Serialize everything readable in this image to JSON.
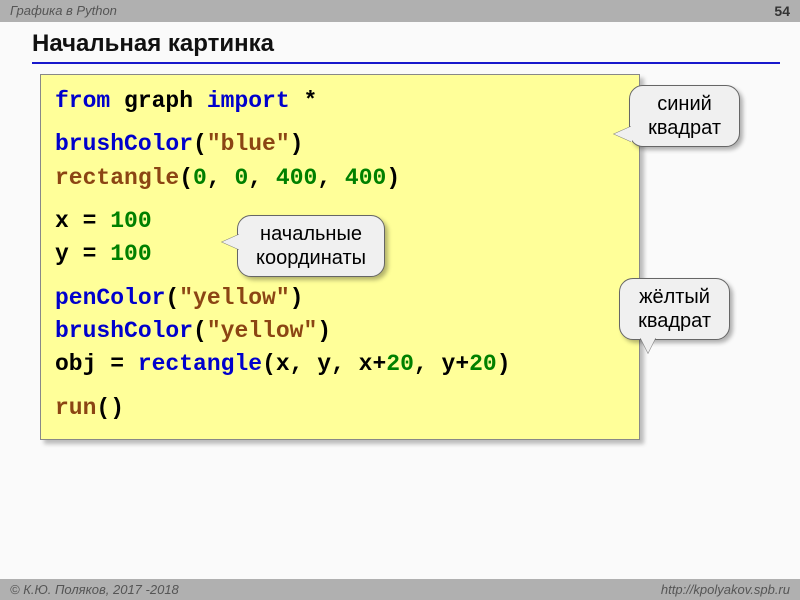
{
  "header": {
    "topic": "Графика в Python",
    "page": "54"
  },
  "title": "Начальная картинка",
  "code": {
    "l1": {
      "a": "from",
      "b": " graph ",
      "c": "import",
      "d": " *"
    },
    "l2": {
      "a": "brushColor",
      "b": "(",
      "c": "\"blue\"",
      "d": ")"
    },
    "l3": {
      "a": "rectangle",
      "b": "(",
      "n1": "0",
      "c1": ", ",
      "n2": "0",
      "c2": ", ",
      "n3": "400",
      "c3": ", ",
      "n4": "400",
      "d": ")"
    },
    "l4": {
      "a": "x = ",
      "n": "100"
    },
    "l5": {
      "a": "y = ",
      "n": "100"
    },
    "l6": {
      "a": "penColor",
      "b": "(",
      "c": "\"yellow\"",
      "d": ")"
    },
    "l7": {
      "a": "brushColor",
      "b": "(",
      "c": "\"yellow\"",
      "d": ")"
    },
    "l8": {
      "a": "obj = ",
      "b": "rectangle",
      "c": "(x, y, x+",
      "n1": "20",
      "d": ", y+",
      "n2": "20",
      "e": ")"
    },
    "l9": {
      "a": "run",
      "b": "()"
    }
  },
  "callouts": {
    "c1a": "синий",
    "c1b": "квадрат",
    "c2a": "начальные",
    "c2b": "координаты",
    "c3a": "жёлтый",
    "c3b": "квадрат"
  },
  "footer": {
    "left": "© К.Ю. Поляков, 2017 -2018",
    "right": "http://kpolyakov.spb.ru"
  }
}
